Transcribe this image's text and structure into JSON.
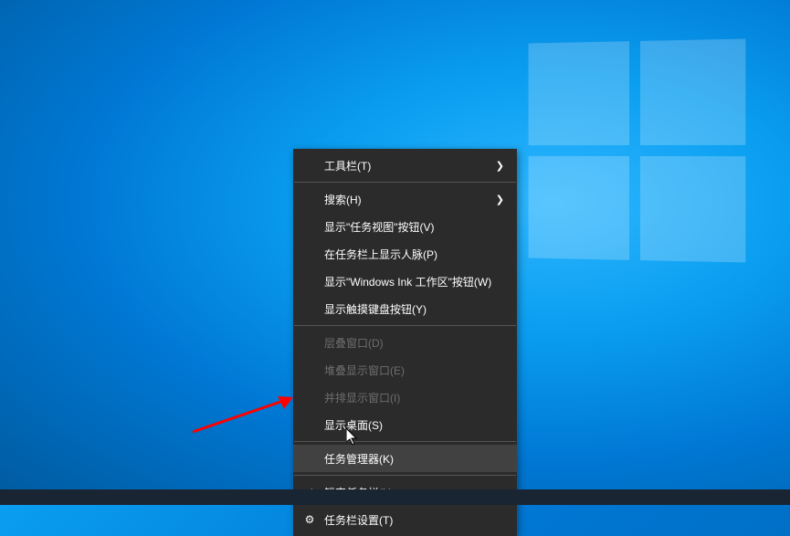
{
  "menu": {
    "items": [
      {
        "label": "工具栏(T)",
        "hasSubmenu": true
      },
      {
        "label": "搜索(H)",
        "hasSubmenu": true
      },
      {
        "label": "显示\"任务视图\"按钮(V)"
      },
      {
        "label": "在任务栏上显示人脉(P)"
      },
      {
        "label": "显示\"Windows Ink 工作区\"按钮(W)"
      },
      {
        "label": "显示触摸键盘按钮(Y)"
      },
      {
        "label": "层叠窗口(D)",
        "disabled": true
      },
      {
        "label": "堆叠显示窗口(E)",
        "disabled": true
      },
      {
        "label": "并排显示窗口(I)",
        "disabled": true
      },
      {
        "label": "显示桌面(S)"
      },
      {
        "label": "任务管理器(K)",
        "highlighted": true
      },
      {
        "label": "锁定任务栏(L)",
        "icon": "check"
      },
      {
        "label": "任务栏设置(T)",
        "icon": "gear"
      }
    ]
  }
}
